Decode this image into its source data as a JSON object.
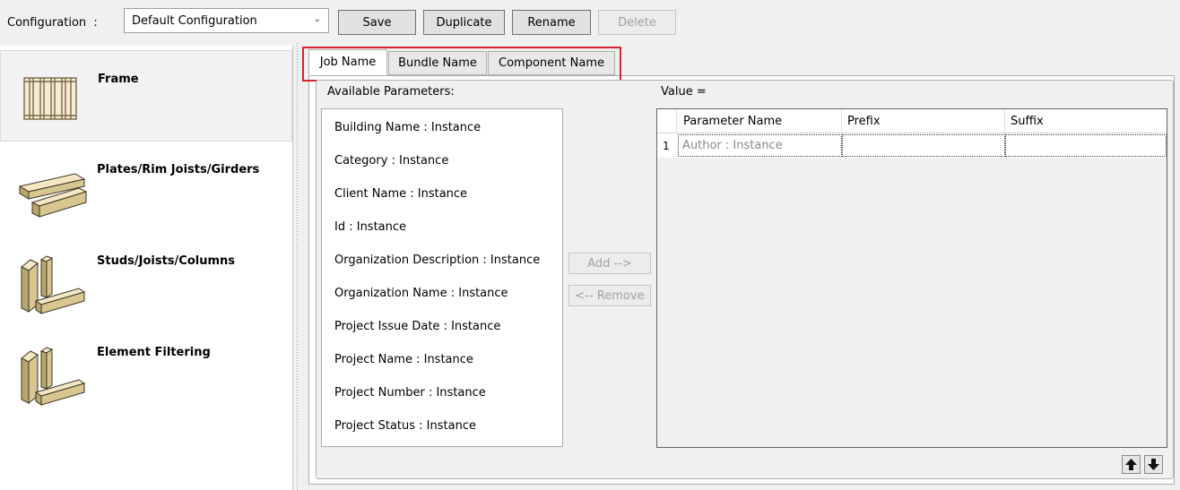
{
  "toolbar": {
    "config_label": "Configuration  :",
    "config_value": "Default Configuration",
    "buttons": {
      "save": "Save",
      "duplicate": "Duplicate",
      "rename": "Rename",
      "delete": "Delete"
    }
  },
  "sidebar": {
    "items": [
      {
        "label": "Frame",
        "icon": "frame-wall-icon",
        "selected": true
      },
      {
        "label": "Plates/Rim Joists/Girders",
        "icon": "plates-icon",
        "selected": false
      },
      {
        "label": "Studs/Joists/Columns",
        "icon": "studs-icon",
        "selected": false
      },
      {
        "label": "Element Filtering",
        "icon": "element-filtering-icon",
        "selected": false
      }
    ]
  },
  "tabs": [
    {
      "label": "Job Name",
      "active": true
    },
    {
      "label": "Bundle Name",
      "active": false
    },
    {
      "label": "Component Name",
      "active": false
    }
  ],
  "highlight_color": "#d9232a",
  "available": {
    "label": "Available Parameters:",
    "items": [
      "Building Name : Instance",
      "Category : Instance",
      "Client Name : Instance",
      "Id : Instance",
      "Organization Description : Instance",
      "Organization Name : Instance",
      "Project Issue Date : Instance",
      "Project Name : Instance",
      "Project Number : Instance",
      "Project Status : Instance"
    ]
  },
  "actions": {
    "add": "Add -->",
    "remove": "<-- Remove"
  },
  "value": {
    "label": "Value =",
    "columns": [
      "Parameter Name",
      "Prefix",
      "Suffix"
    ],
    "rows": [
      {
        "num": "1",
        "name": "Author : Instance",
        "prefix": "",
        "suffix": ""
      }
    ]
  },
  "order_icons": {
    "up": "arrow-up-icon",
    "down": "arrow-down-icon"
  }
}
